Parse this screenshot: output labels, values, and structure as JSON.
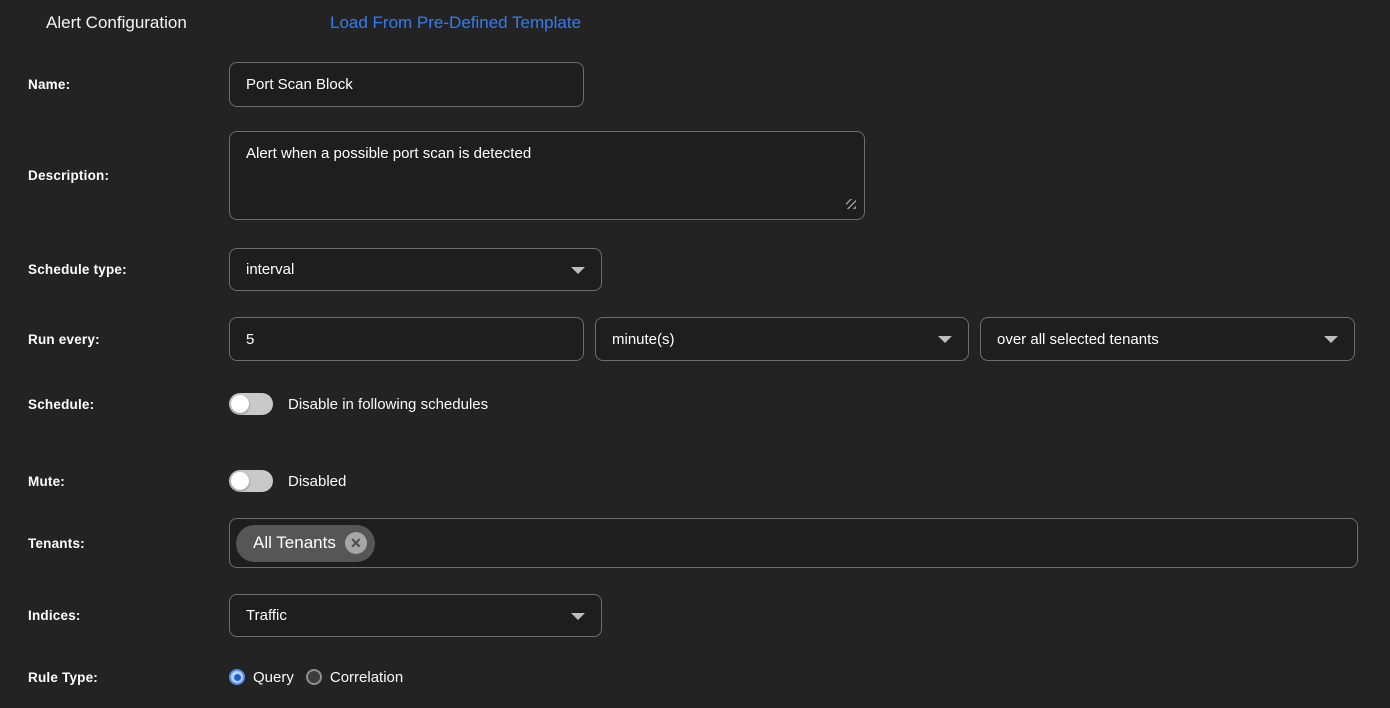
{
  "page": {
    "title": "Alert Configuration",
    "template_link": "Load From Pre-Defined Template"
  },
  "colors": {
    "background": "#232323",
    "control_background": "#1e1e1e",
    "control_border": "#6d6d6d",
    "link_blue": "#2e7df6",
    "toggle_track": "#c9c9c9",
    "chip_background": "#565656",
    "radio_selected_blue": "#1f5fd6"
  },
  "fields": {
    "name": {
      "label": "Name:",
      "value": "Port Scan Block"
    },
    "description": {
      "label": "Description:",
      "value": "Alert when a possible port scan is detected"
    },
    "schedule_type": {
      "label": "Schedule type:",
      "value": "interval"
    },
    "run_every": {
      "label": "Run every:",
      "value": "5",
      "unit": "minute(s)",
      "scope": "over all selected tenants"
    },
    "schedule": {
      "label": "Schedule:",
      "toggle_state": "off",
      "toggle_label": "Disable in following schedules"
    },
    "mute": {
      "label": "Mute:",
      "toggle_state": "off",
      "toggle_label": "Disabled"
    },
    "tenants": {
      "label": "Tenants:",
      "chips": [
        {
          "text": "All Tenants",
          "remove_icon": "close-icon"
        }
      ]
    },
    "indices": {
      "label": "Indices:",
      "value": "Traffic"
    },
    "rule_type": {
      "label": "Rule Type:",
      "options": [
        {
          "label": "Query",
          "selected": true
        },
        {
          "label": "Correlation",
          "selected": false
        }
      ]
    }
  }
}
